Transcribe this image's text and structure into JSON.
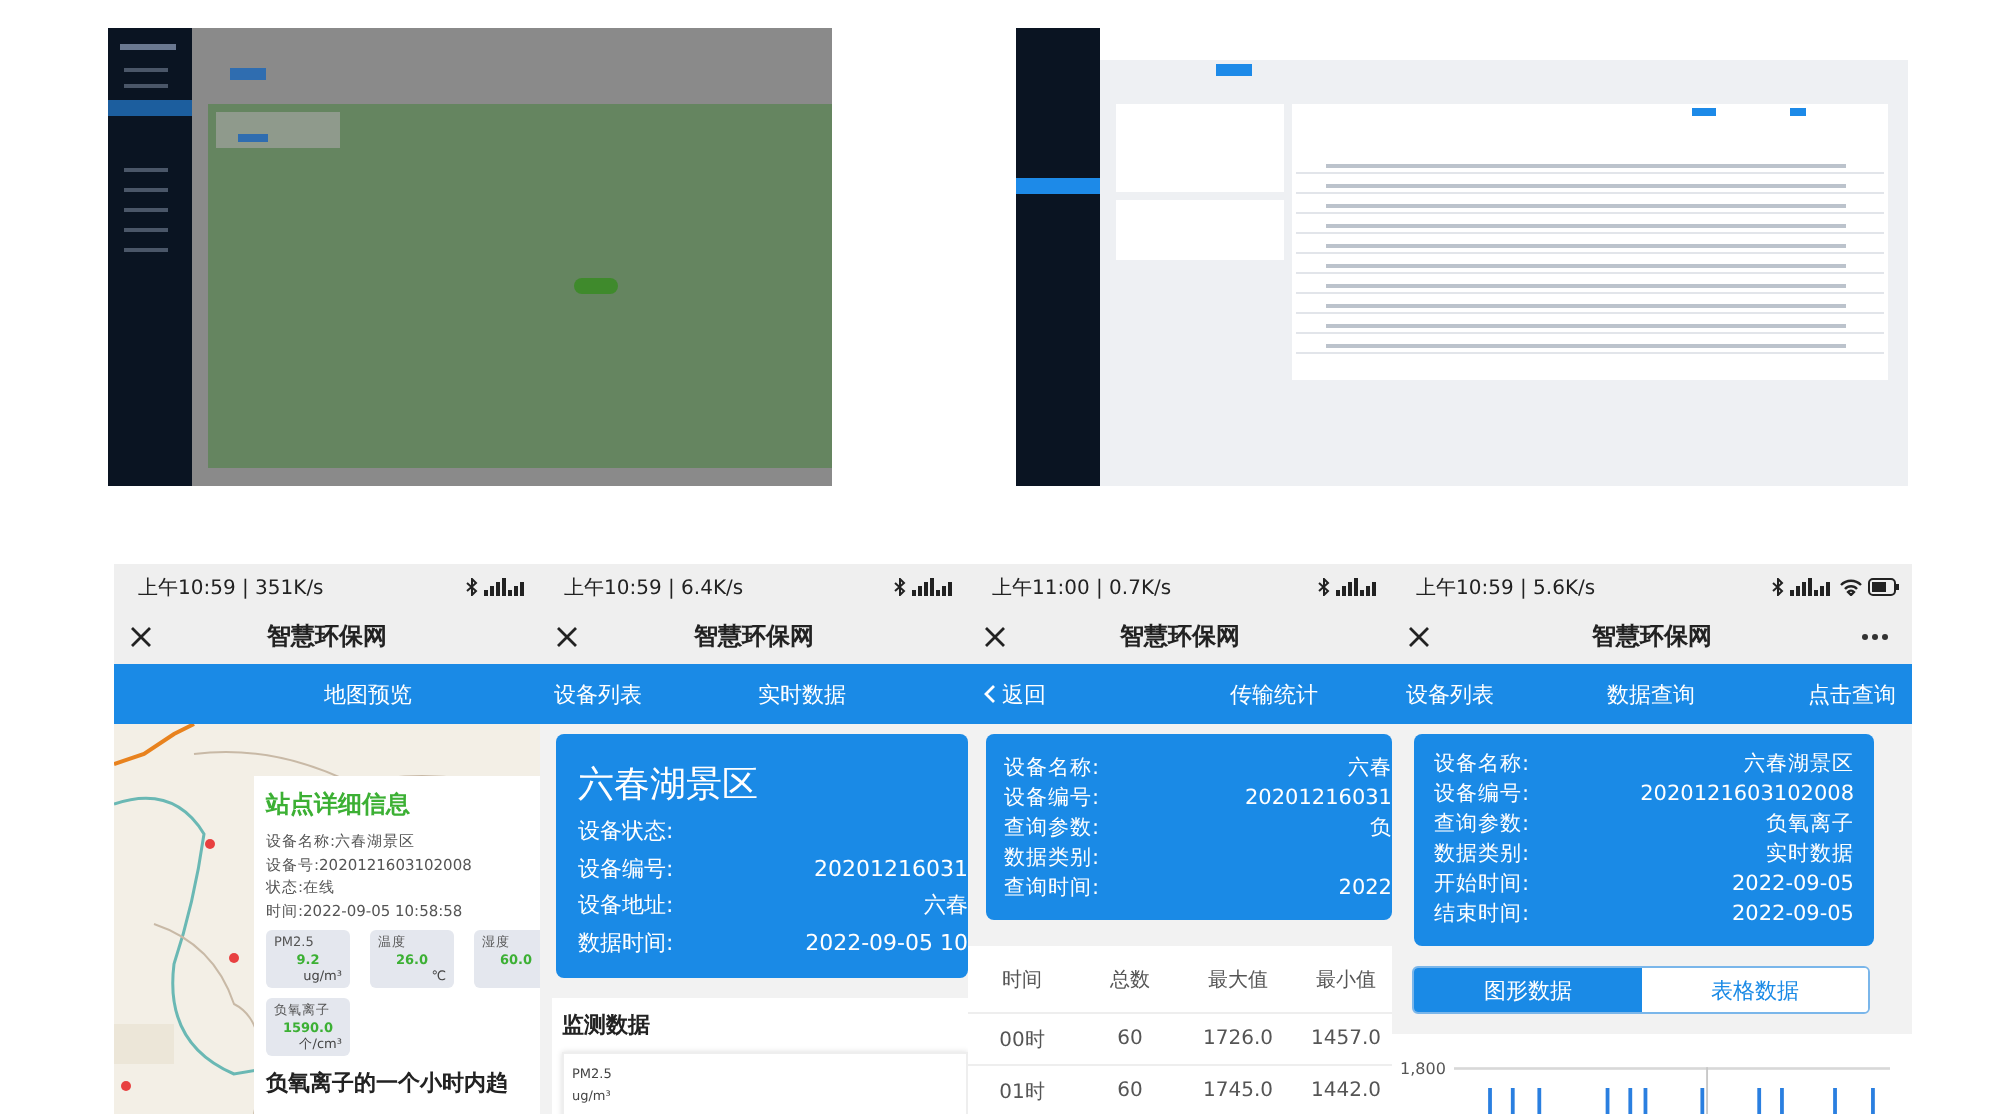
{
  "desktop_views": [
    {
      "kind": "map_view"
    },
    {
      "kind": "table_view"
    }
  ],
  "phones": [
    {
      "kind": "map",
      "status_text": "上午10:59 | 351K/s",
      "status_icons": [
        {
          "kind": "bluetooth"
        },
        {
          "kind": "signal"
        }
      ],
      "title": "智慧环保网",
      "nav": [
        "地图预览"
      ],
      "popup": {
        "title": "站点详细信息",
        "lines": [
          "设备名称:六春湖景区",
          "设备号:2020121603102008",
          "状态:在线",
          "时间:2022-09-05 10:58:58"
        ],
        "tiles": [
          {
            "label": "PM2.5",
            "value": "9.2",
            "unit": "ug/m³"
          },
          {
            "label": "温度",
            "value": "26.0",
            "unit": "℃"
          },
          {
            "label": "湿度",
            "value": "60.0"
          },
          {
            "label": "负氧离子",
            "value": "1590.0",
            "unit": "个/cm³"
          }
        ],
        "trend_title": "负氧离子的一个小时内趋"
      }
    },
    {
      "kind": "device",
      "status_text": "上午10:59 | 6.4K/s",
      "status_icons": [
        {
          "kind": "bluetooth"
        },
        {
          "kind": "signal"
        }
      ],
      "title": "智慧环保网",
      "nav": [
        "设备列表",
        "实时数据"
      ],
      "card_title": "六春湖景区",
      "rows": [
        {
          "label": "设备状态:"
        },
        {
          "label": "设备编号:",
          "value": "20201216031"
        },
        {
          "label": "设备地址:",
          "value": "六春"
        },
        {
          "label": "数据时间:",
          "value": "2022-09-05 10"
        }
      ],
      "section": "监测数据",
      "item": {
        "label": "PM2.5",
        "unit": "ug/m³"
      }
    },
    {
      "kind": "stats",
      "status_text": "上午11:00 | 0.7K/s",
      "status_icons": [
        {
          "kind": "bluetooth"
        },
        {
          "kind": "signal"
        }
      ],
      "title": "智慧环保网",
      "back": "返回",
      "nav": [
        "传输统计"
      ],
      "rows": [
        {
          "label": "设备名称:",
          "value": "六春"
        },
        {
          "label": "设备编号:",
          "value": "20201216031"
        },
        {
          "label": "查询参数:",
          "value": "负"
        },
        {
          "label": "数据类别:"
        },
        {
          "label": "查询时间:",
          "value": "2022"
        }
      ],
      "table": {
        "columns": [
          "时间",
          "总数",
          "最大值",
          "最小值"
        ],
        "rows": [
          [
            "00时",
            "60",
            "1726.0",
            "1457.0"
          ],
          [
            "01时",
            "60",
            "1745.0",
            "1442.0"
          ]
        ]
      }
    },
    {
      "kind": "query",
      "status_text": "上午10:59 | 5.6K/s",
      "status_icons": [
        {
          "kind": "bluetooth"
        },
        {
          "kind": "signal"
        },
        {
          "kind": "wifi"
        },
        {
          "kind": "battery"
        }
      ],
      "title": "智慧环保网",
      "actions": [
        {
          "kind": "more"
        }
      ],
      "nav": [
        "设备列表",
        "数据查询",
        "点击查询"
      ],
      "rows": [
        {
          "label": "设备名称:",
          "value": "六春湖景区"
        },
        {
          "label": "设备编号:",
          "value": "2020121603102008"
        },
        {
          "label": "查询参数:",
          "value": "负氧离子"
        },
        {
          "label": "数据类别:",
          "value": "实时数据"
        },
        {
          "label": "开始时间:",
          "value": "2022-09-05"
        },
        {
          "label": "结束时间:",
          "value": "2022-09-05"
        }
      ],
      "tabs": [
        {
          "label": "图形数据",
          "selected": true
        },
        {
          "label": "表格数据",
          "selected": false
        }
      ],
      "axis_label": "1,800"
    }
  ]
}
